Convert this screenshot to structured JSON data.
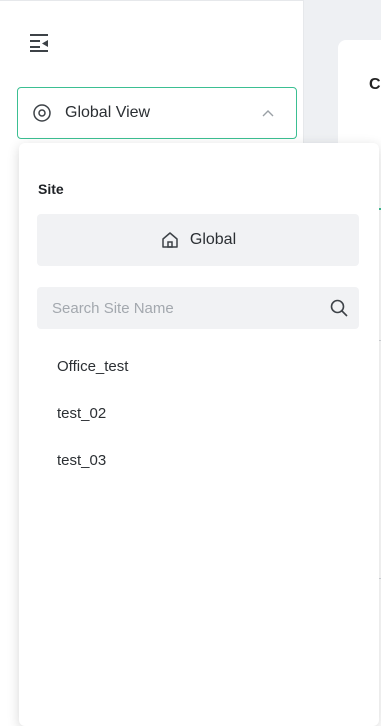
{
  "sidebar": {
    "collapse_icon": "collapse-sidebar-icon",
    "view_selector": {
      "icon": "location-pin-icon",
      "label": "Global View",
      "chevron": "chevron-up-icon"
    }
  },
  "main": {
    "title": "C"
  },
  "dropdown": {
    "section_label": "Site",
    "global_button": {
      "icon": "home-icon",
      "label": "Global"
    },
    "search": {
      "placeholder": "Search Site Name",
      "value": "",
      "icon": "search-icon"
    },
    "sites": [
      {
        "name": "Office_test"
      },
      {
        "name": "test_02"
      },
      {
        "name": "test_03"
      }
    ]
  },
  "colors": {
    "accent": "#3bbf92",
    "text": "#2b2f33",
    "muted_bg": "#f1f2f4",
    "placeholder": "#a3a8ae"
  }
}
